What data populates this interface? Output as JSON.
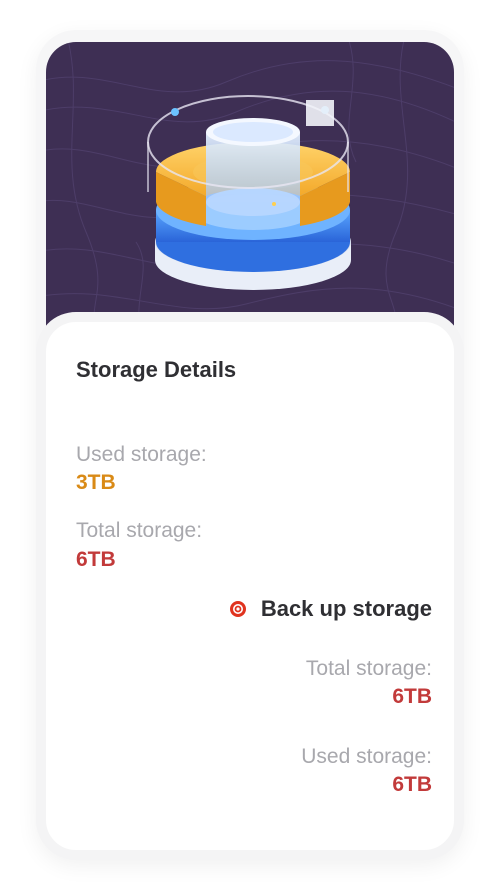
{
  "card": {
    "title": "Storage Details",
    "used_label": "Used storage:",
    "used_value": "3TB",
    "total_label": "Total storage:",
    "total_value": "6TB"
  },
  "backup": {
    "label": "Back up storage",
    "total_label": "Total storage:",
    "total_value": "6TB",
    "used_label": "Used storage:",
    "used_value": "6TB"
  },
  "icons": {
    "backup": "record-dot-icon",
    "hero": "storage-disk-illustration"
  },
  "colors": {
    "hero_bg": "#3e2f54",
    "used_value": "#d98a16",
    "total_value": "#c23a3a",
    "backup_icon": "#e0331f",
    "disk_orange": "#f6b63c",
    "disk_blue": "#3d8cf4"
  }
}
